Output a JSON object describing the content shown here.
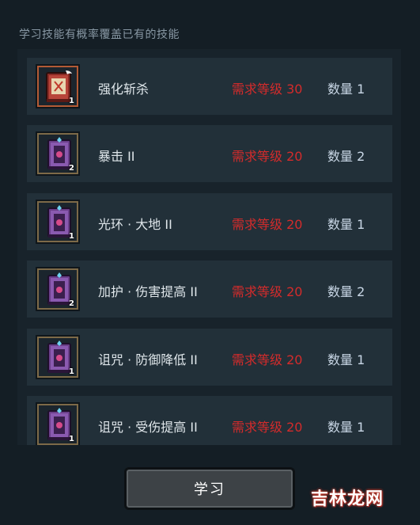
{
  "hint": "学习技能有概率覆盖已有的技能",
  "skills": [
    {
      "name": "强化斩杀",
      "requirement": "需求等级 30",
      "count": "数量 1",
      "badge": "1",
      "icon": "red-skill-book-icon"
    },
    {
      "name": "暴击 II",
      "requirement": "需求等级 20",
      "count": "数量 2",
      "badge": "2",
      "icon": "skill-book-icon"
    },
    {
      "name": "光环 · 大地 II",
      "requirement": "需求等级 20",
      "count": "数量 1",
      "badge": "1",
      "icon": "skill-book-icon"
    },
    {
      "name": "加护 · 伤害提高 II",
      "requirement": "需求等级 20",
      "count": "数量 2",
      "badge": "2",
      "icon": "skill-book-icon"
    },
    {
      "name": "诅咒 · 防御降低 II",
      "requirement": "需求等级 20",
      "count": "数量 1",
      "badge": "1",
      "icon": "skill-book-icon"
    },
    {
      "name": "诅咒 · 受伤提高 II",
      "requirement": "需求等级 20",
      "count": "数量 1",
      "badge": "1",
      "icon": "skill-book-icon"
    }
  ],
  "learn_button": "学习",
  "watermark": "吉林龙网",
  "colors": {
    "background": "#141e25",
    "row": "#223039",
    "requirement": "#d42b2b",
    "count": "#c9d7e6"
  }
}
